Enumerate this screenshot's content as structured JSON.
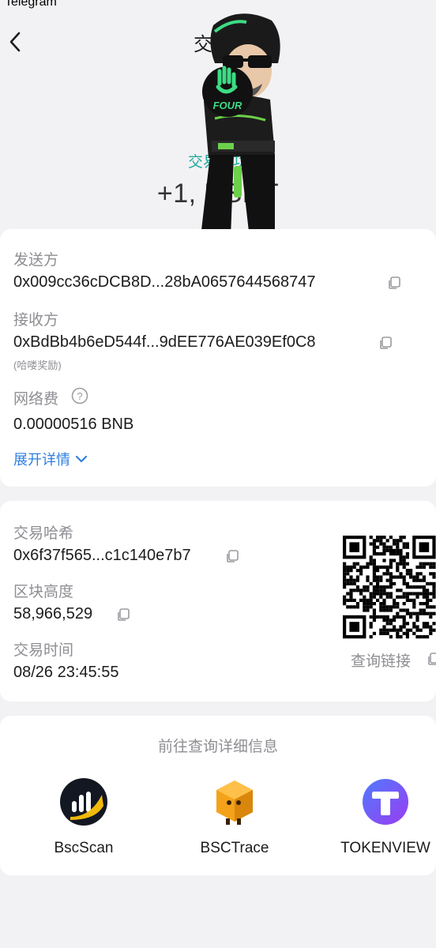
{
  "status_bar": {
    "app_name": "Telegram"
  },
  "nav": {
    "title": "交"
  },
  "tx": {
    "status": "交易成功",
    "amount": "+1,   USDT"
  },
  "sticker": {
    "badge_text": "FOUR"
  },
  "details": {
    "sender_label": "发送方",
    "sender_value": "0x009cc36cDCB8D...28bA0657644568747",
    "receiver_label": "接收方",
    "receiver_value": "0xBdBb4b6eD544f...9dEE776AE039Ef0C8",
    "receiver_note": "(哈喽奖励)",
    "fee_label": "网络费",
    "fee_value": "0.00000516 BNB",
    "expand_label": "展开详情"
  },
  "chain": {
    "hash_label": "交易哈希",
    "hash_value": "0x6f37f565...c1c140e7b7",
    "block_label": "区块高度",
    "block_value": "58,966,529",
    "time_label": "交易时间",
    "time_value": "08/26 23:45:55",
    "query_link_label": "查询链接"
  },
  "explorers": {
    "title": "前往查询详细信息",
    "items": [
      {
        "name": "BscScan",
        "icon": "bscscan-logo"
      },
      {
        "name": "BSCTrace",
        "icon": "bsctrace-logo"
      },
      {
        "name": "TOKENVIEW",
        "icon": "tokenview-logo"
      }
    ]
  },
  "colors": {
    "success": "#21a99b",
    "link": "#2f7fe0",
    "muted": "#8e8e93",
    "background": "#f2f2f4"
  }
}
